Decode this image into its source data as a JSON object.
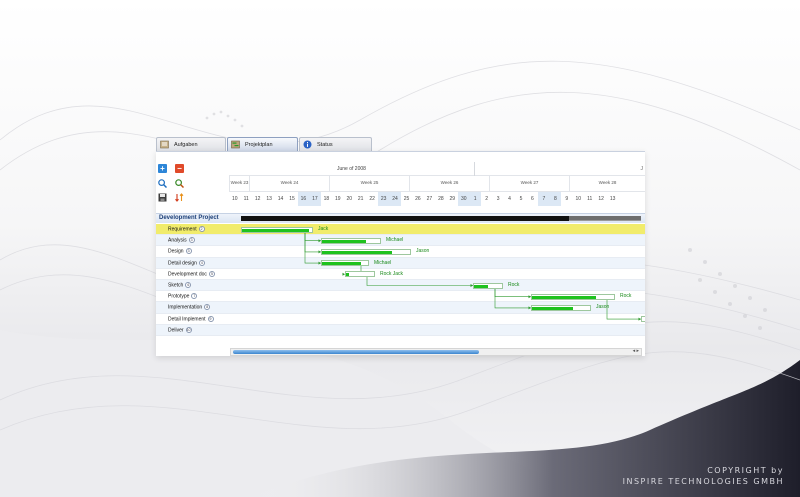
{
  "tabs": [
    {
      "label": "Aufgaben",
      "icon": "tasks-icon"
    },
    {
      "label": "Projektplan",
      "icon": "project-plan-icon"
    },
    {
      "label": "Status",
      "icon": "info-icon"
    }
  ],
  "toolbar": {
    "add": "add-task-icon",
    "delete": "delete-task-icon",
    "zoom_in": "zoom-in-icon",
    "zoom_out": "zoom-out-icon",
    "save": "save-icon",
    "sort": "sort-icon"
  },
  "timeline": {
    "month": "June of 2008",
    "more": "J",
    "weeks": [
      "Week 23",
      "Week 24",
      "Week 25",
      "Week 26",
      "Week 27",
      "Week 28"
    ],
    "days": [
      "10",
      "11",
      "12",
      "13",
      "14",
      "15",
      "16",
      "17",
      "18",
      "19",
      "20",
      "21",
      "22",
      "23",
      "24",
      "25",
      "26",
      "27",
      "28",
      "29",
      "30",
      "1",
      "2",
      "3",
      "4",
      "5",
      "6",
      "7",
      "8",
      "9",
      "10",
      "11",
      "12",
      "13"
    ],
    "weekend_days": [
      6,
      7,
      13,
      14,
      20,
      21,
      27,
      28
    ]
  },
  "project": {
    "title": "Development Project",
    "progress": 0.82
  },
  "tasks": [
    {
      "name": "Requirement",
      "badge": "2",
      "resource": "Jack",
      "selected": true,
      "progress": 0.95
    },
    {
      "name": "Analysis",
      "badge": "3",
      "resource": "Michael",
      "progress": 0.75
    },
    {
      "name": "Design",
      "badge": "3",
      "resource": "Jason",
      "progress": 0.8
    },
    {
      "name": "Detail design",
      "badge": "4",
      "resource": "Michael",
      "progress": 0.85
    },
    {
      "name": "Development doc",
      "badge": "5",
      "resource": "Rock Jack",
      "progress": 0.1
    },
    {
      "name": "Sketch",
      "badge": "6",
      "resource": "Rock",
      "progress": 0.5
    },
    {
      "name": "Prototype",
      "badge": "7",
      "resource": "Rock",
      "progress": 0.78
    },
    {
      "name": "Implementation",
      "badge": "8",
      "resource": "Jason",
      "progress": 0.7
    },
    {
      "name": "Detail Implement",
      "badge": "9",
      "resource": "",
      "progress": 0
    },
    {
      "name": "Deliver",
      "badge": "10",
      "resource": "",
      "progress": 0
    }
  ],
  "scroll": {
    "arrows": "◂ ▸"
  },
  "copyright": {
    "line1": "COPYRIGHT by",
    "line2": "INSPIRE TECHNOLOGIES GMBH"
  }
}
